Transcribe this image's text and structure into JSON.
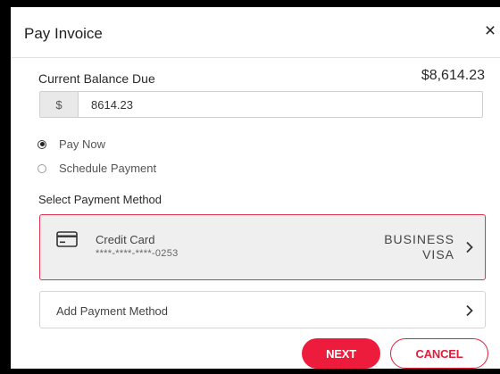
{
  "dialog": {
    "title": "Pay Invoice",
    "close_glyph": "×"
  },
  "balance": {
    "label": "Current Balance Due",
    "value": "$8,614.23",
    "currency_symbol": "$",
    "amount_input_value": "8614.23"
  },
  "payment_timing": {
    "options": [
      {
        "label": "Pay Now",
        "selected": true
      },
      {
        "label": "Schedule Payment",
        "selected": false
      }
    ]
  },
  "payment_method": {
    "section_label": "Select Payment Method",
    "selected_card": {
      "name": "Credit Card",
      "number_masked": "****-****-****-0253",
      "type_line1": "BUSINESS",
      "type_line2": "VISA",
      "icon": "credit-card-icon"
    },
    "add_label": "Add Payment Method"
  },
  "buttons": {
    "next": "NEXT",
    "cancel": "CANCEL"
  },
  "colors": {
    "accent": "#ed1c3c",
    "selected_border": "#e0324e",
    "frame": "#000000"
  }
}
